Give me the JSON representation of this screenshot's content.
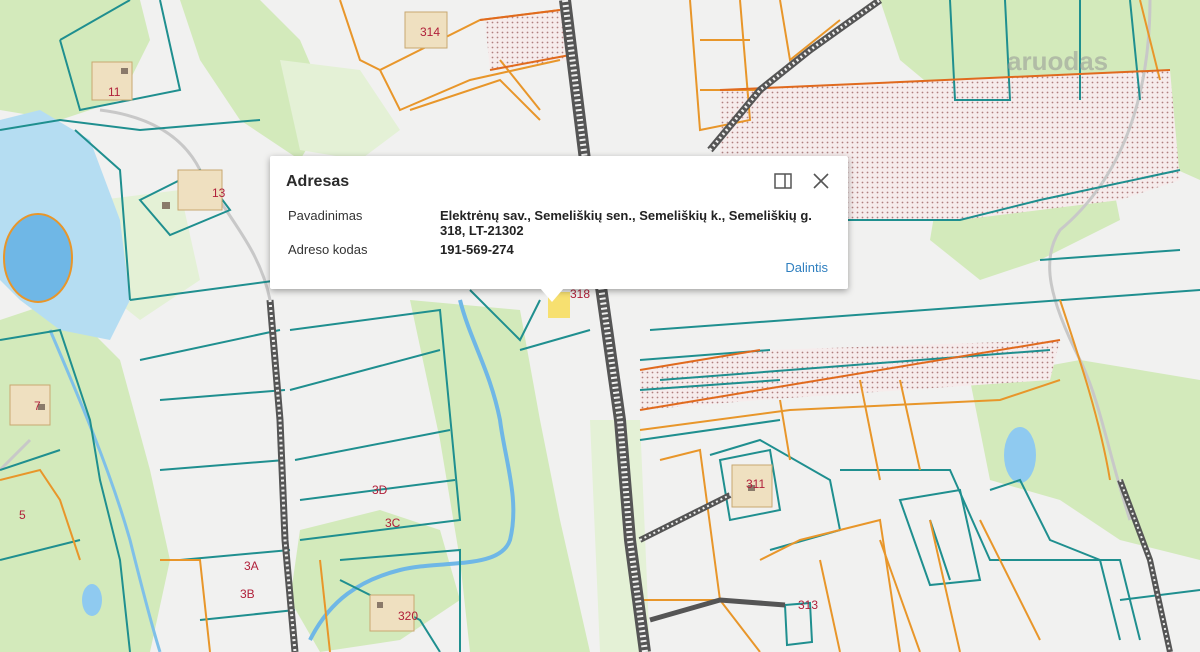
{
  "map": {
    "watermark": "aruodas",
    "plot_labels": [
      {
        "id": "314",
        "text": "314"
      },
      {
        "id": "11",
        "text": "11"
      },
      {
        "id": "13",
        "text": "13"
      },
      {
        "id": "7",
        "text": "7"
      },
      {
        "id": "5",
        "text": "5"
      },
      {
        "id": "3D",
        "text": "3D"
      },
      {
        "id": "3C",
        "text": "3C"
      },
      {
        "id": "3A",
        "text": "3A"
      },
      {
        "id": "3B",
        "text": "3B"
      },
      {
        "id": "320",
        "text": "320"
      },
      {
        "id": "311",
        "text": "311"
      },
      {
        "id": "313",
        "text": "313"
      },
      {
        "id": "318",
        "text": "318"
      }
    ],
    "colors": {
      "background": "#f1f1f0",
      "forest": "#cfe8b5",
      "water": "#7fc0e8",
      "parcel_teal": "#1f8f8f",
      "parcel_orange": "#e8962a",
      "railway": "#555555",
      "road_gray": "#c8c8c8"
    }
  },
  "popup": {
    "title": "Adresas",
    "rows": [
      {
        "label": "Pavadinimas",
        "value": "Elektrėnų sav., Semeliškių sen., Semeliškių k., Semeliškių g. 318, LT-21302"
      },
      {
        "label": "Adreso kodas",
        "value": "191-569-274"
      }
    ],
    "share_label": "Dalintis",
    "dock_icon": "dock-panel-icon",
    "close_icon": "close-icon"
  }
}
